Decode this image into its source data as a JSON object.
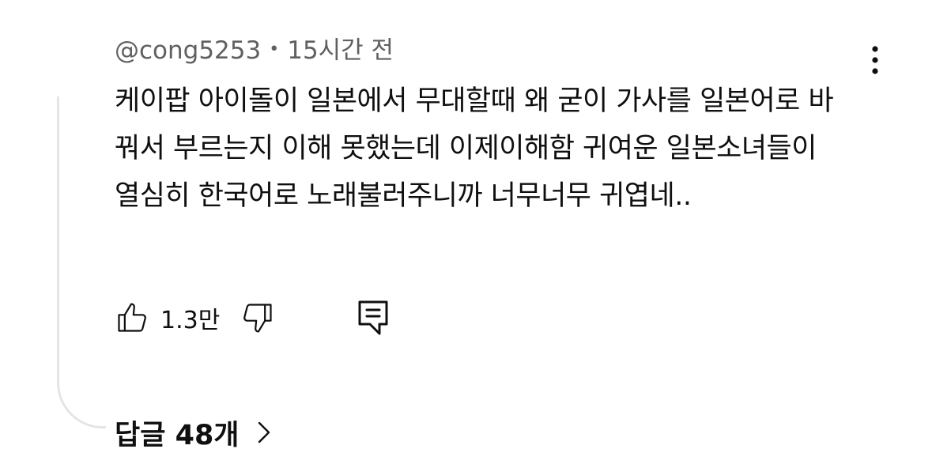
{
  "comment": {
    "author": "@cong5253",
    "separator": "•",
    "timestamp": "15시간 전",
    "text": "케이팝 아이돌이 일본에서 무대할때 왜 굳이 가사를 일본어로 바꿔서 부르는지 이해 못했는데 이제이해함 귀여운 일본소녀들이 열심히 한국어로 노래불러주니까 너무너무 귀엽네..",
    "like_count": "1.3만",
    "replies_label": "답글 48개"
  },
  "icons": {
    "menu": "more-vertical-icon",
    "like": "thumbs-up-icon",
    "dislike": "thumbs-down-icon",
    "reply": "comment-reply-icon",
    "expand": "chevron-right-icon"
  },
  "colors": {
    "text_primary": "#0f0f0f",
    "text_secondary": "#606060",
    "thread_line": "#e5e5e5"
  }
}
